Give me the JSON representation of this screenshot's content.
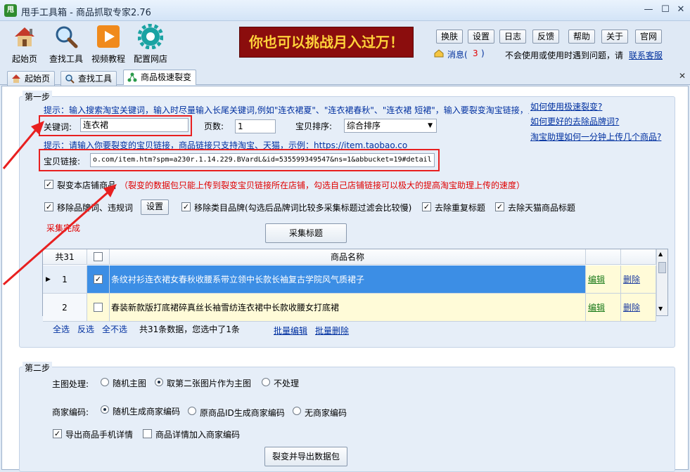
{
  "window": {
    "title": "甩手工具箱 - 商品抓取专家2.76",
    "app_icon_text": "甩",
    "min": "—",
    "max": "☐",
    "close": "✕"
  },
  "toolbar": {
    "items": [
      {
        "label": "起始页",
        "icon": "home-icon"
      },
      {
        "label": "查找工具",
        "icon": "magnifier-icon"
      },
      {
        "label": "视频教程",
        "icon": "video-play-icon"
      },
      {
        "label": "配置网店",
        "icon": "gear-icon"
      }
    ],
    "banner": "你也可以挑战月入过万！",
    "buttons": [
      "换肤",
      "设置",
      "日志",
      "反馈",
      "帮助",
      "关于",
      "官网"
    ],
    "message_label": "消息(",
    "message_count": "3",
    "message_close": ")",
    "help_text": "不会使用或使用时遇到问题，请",
    "support_link": "联系客服"
  },
  "tabs": [
    {
      "label": "起始页",
      "icon": "home-icon"
    },
    {
      "label": "查找工具",
      "icon": "magnifier-icon"
    },
    {
      "label": "商品极速裂变",
      "icon": "split-icon",
      "active": true
    }
  ],
  "step1": {
    "title": "第一步",
    "hint1": "提示：输入搜索淘宝关键词，输入时尽量输入长尾关键词,例如\"连衣裙夏\"、\"连衣裙春秋\"、\"连衣裙 短裙\"，输入要裂变淘宝链接，点击采集标题",
    "keyword_label": "关键词:",
    "keyword_value": "连衣裙",
    "pages_label": "页数:",
    "pages_value": "1",
    "sort_label": "宝贝排序:",
    "sort_value": "综合排序",
    "hint2": "提示：请输入你要裂变的宝贝链接，商品链接只支持淘宝、天猫，示例：https://item.taobao.co",
    "link_label": "宝贝链接:",
    "link_value": "o.com/item.htm?spm=a230r.1.14.229.BVardL&id=535599349547&ns=1&abbucket=19#detail",
    "help_links": [
      "如何使用极速裂变?",
      "如何更好的去除品牌词?",
      "淘宝助理如何一分钟上传几个商品?"
    ],
    "opt_same_shop": "裂变本店铺商品",
    "opt_same_shop_note": "（裂变的数据包只能上传到裂变宝贝链接所在店铺，勾选自己店铺链接可以极大的提高淘宝助理上传的速度）",
    "opt_remove_brand": "移除品牌词、违规词",
    "set_btn": "设置",
    "opt_remove_cat_brand": "移除类目品牌(勾选后品牌词比较多采集标题过滤会比较慢)",
    "opt_remove_dup": "去除重复标题",
    "opt_remove_tmall": "去除天猫商品标题",
    "status": "采集完成",
    "collect_btn": "采集标题"
  },
  "table": {
    "header_count": "共31",
    "header_name": "商品名称",
    "rows": [
      {
        "no": "1",
        "checked": true,
        "name": "条纹衬衫连衣裙女春秋收腰系带立领中长款长袖复古学院风气质裙子",
        "edit": "编辑",
        "del": "删除"
      },
      {
        "no": "2",
        "checked": false,
        "name": "春装新款版打底裙碎真丝长袖雪纺连衣裙中长款收腰女打底裙",
        "edit": "编辑",
        "del": "删除"
      }
    ]
  },
  "table_footer": {
    "select_all": "全选",
    "invert": "反选",
    "deselect": "全不选",
    "summary": "共31条数据，您选中了1条",
    "batch_edit": "批量编辑",
    "batch_delete": "批量删除"
  },
  "step2": {
    "title": "第二步",
    "main_img_label": "主图处理:",
    "main_img_opts": [
      "随机主图",
      "取第二张图片作为主图",
      "不处理"
    ],
    "code_label": "商家编码:",
    "code_opts": [
      "随机生成商家编码",
      "原商品ID生成商家编码",
      "无商家编码"
    ],
    "opt_mobile": "导出商品手机详情",
    "opt_detail_code": "商品详情加入商家编码",
    "export_btn": "裂变并导出数据包"
  },
  "colors": {
    "accent_red": "#e00000",
    "link_blue": "#0030a0",
    "selection": "#3c8ee5",
    "banner_bg": "#8b0d0d",
    "banner_text": "#ffd23a"
  }
}
